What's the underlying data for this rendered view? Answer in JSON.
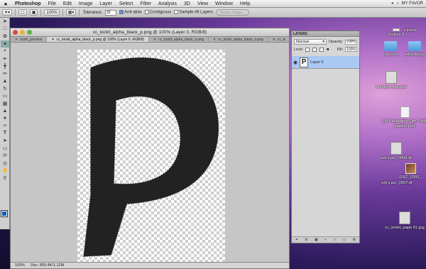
{
  "menubar": {
    "apple": "",
    "app_name": "Photoshop",
    "items": [
      "File",
      "Edit",
      "Image",
      "Layer",
      "Select",
      "Filter",
      "Analysis",
      "3D",
      "View",
      "Window",
      "Help"
    ],
    "status_right": "MY FAVOR"
  },
  "options_bar": {
    "zoom": "100%",
    "tolerance_label": "Tolerance:",
    "tolerance_value": "32",
    "anti_alias_label": "Anti-alias",
    "contiguous_label": "Contiguous",
    "sample_all_label": "Sample All Layers",
    "refine_edge_label": "Refine Edge..."
  },
  "document": {
    "title": "cc_kickit_alpha_black_p.png @ 100% (Layer 0, RGB/8)",
    "tabs": [
      "tooth_preview",
      "cc_kickit_alpha_black_p.png @ 100% (Layer 0, RGB/8)",
      "cc_kickit_alpha_black_n.png",
      "cc_kickit_alpha_black_o.png",
      "cc_ki"
    ],
    "status_zoom": "100%",
    "status_doc": "Doc: 859.4K/1.12M"
  },
  "layers_panel": {
    "title": "LAYERS",
    "blend_mode": "Normal",
    "opacity_label": "Opacity:",
    "opacity_value": "100%",
    "lock_label": "Lock:",
    "fill_label": "Fill:",
    "fill_value": "100%",
    "layer_name": "Layer 0",
    "thumb_letter": "P",
    "footer": "fx"
  },
  "desktop_icons": [
    {
      "label": "Picture 8",
      "kind": "doc"
    },
    {
      "label": "Firefox",
      "kind": "app"
    },
    {
      "label": "Layouts",
      "kind": "folder"
    },
    {
      "label": "advertising",
      "kind": "folder"
    },
    {
      "label": "no labor day.psd",
      "kind": "photo2"
    },
    {
      "label": "SM Packaging Opt 2 with papers.psd",
      "kind": "doc"
    },
    {
      "label": "em's pic_0006.tif",
      "kind": "photo2"
    },
    {
      "label": "DSC_0393_",
      "kind": "photo"
    },
    {
      "label": "em's pic_0007.tif",
      "kind": "photo2"
    },
    {
      "label": "cc_kickit_pape 01.jpg",
      "kind": "photo2"
    }
  ]
}
